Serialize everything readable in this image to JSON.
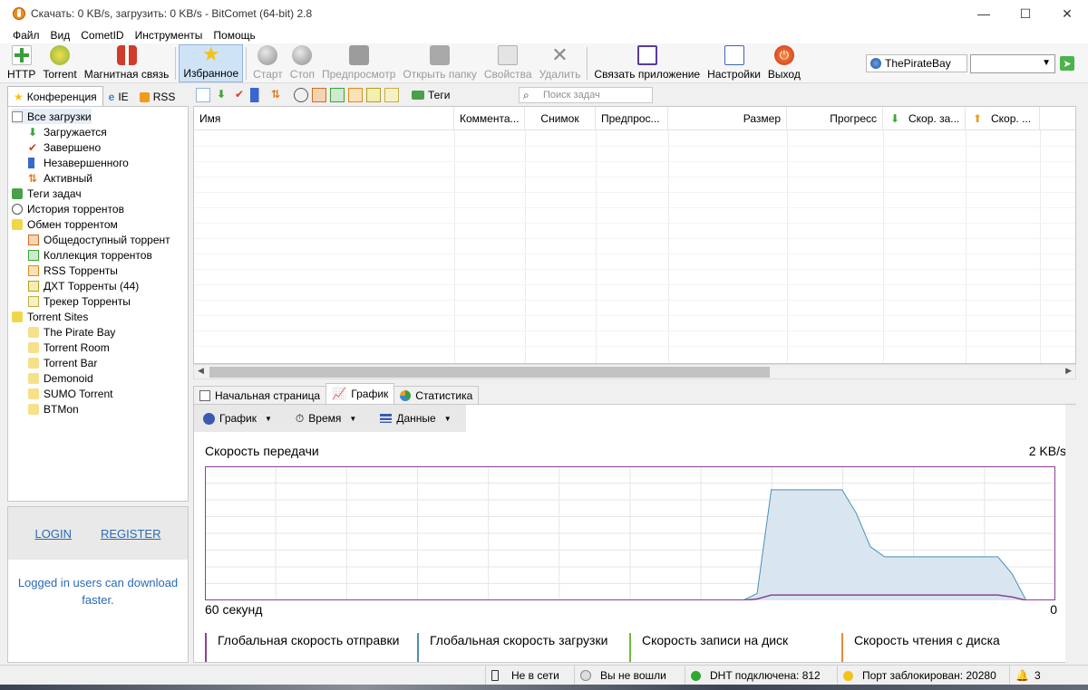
{
  "window": {
    "title": "Скачать: 0 KB/s, загрузить: 0 KB/s - BitComet (64-bit) 2.8",
    "min": "—",
    "max": "☐",
    "close": "✕"
  },
  "menu": [
    "Файл",
    "Вид",
    "CometID",
    "Инструменты",
    "Помощь"
  ],
  "toolbar": {
    "http": "HTTP",
    "torrent": "Torrent",
    "magnet": "Магнитная связь",
    "favorites": "Избранное",
    "start": "Старт",
    "stop": "Стоп",
    "preview": "Предпросмотр",
    "open_folder": "Открыть папку",
    "properties": "Свойства",
    "delete": "Удалить",
    "link_app": "Связать приложение",
    "settings": "Настройки",
    "exit": "Выход"
  },
  "tracker_select": "ThePirateBay",
  "left_tabs": {
    "conf": "Конференция",
    "ie": "IE",
    "rss": "RSS"
  },
  "tree": {
    "all": "Все загрузки",
    "downloading": "Загружается",
    "completed": "Завершено",
    "incomplete": "Незавершенного",
    "active": "Активный",
    "tags": "Теги задач",
    "history": "История торрентов",
    "exchange": "Обмен торрентом",
    "public": "Общедоступный торрент",
    "collection": "Коллекция торрентов",
    "rss": "RSS Торренты",
    "dht": "ДХТ Торренты (44)",
    "tracker": "Трекер Торренты",
    "sites": "Torrent Sites",
    "piratebay": "The Pirate Bay",
    "room": "Torrent Room",
    "bar": "Torrent Bar",
    "demonoid": "Demonoid",
    "sumo": "SUMO Torrent",
    "btmon": "BTMon"
  },
  "login": {
    "login": "LOGIN",
    "register": "REGISTER",
    "msg1": "Logged in users can download",
    "msg2": "faster."
  },
  "subbar": {
    "tags": "Теги",
    "search_placeholder": "Поиск задач"
  },
  "columns": {
    "name": "Имя",
    "comment": "Коммента...",
    "snapshot": "Снимок",
    "preview": "Предпрос...",
    "size": "Размер",
    "progress": "Прогресс",
    "dl": "Скор. за...",
    "ul": "Скор. ..."
  },
  "bottom_tabs": {
    "home": "Начальная страница",
    "graph": "График",
    "stats": "Статистика"
  },
  "graph": {
    "tool_graph": "График",
    "tool_time": "Время",
    "tool_data": "Данные",
    "title": "Скорость передачи",
    "max": "2 KB/s",
    "left": "60 секунд",
    "right": "0",
    "legend": {
      "upload": "Глобальная скорость отправки",
      "download": "Глобальная скорость загрузки",
      "disk_write": "Скорость записи на диск",
      "disk_read": "Скорость чтения с диска"
    }
  },
  "chart_data": {
    "type": "area",
    "title": "Скорость передачи",
    "xlabel": "",
    "ylabel": "",
    "x_range_label": [
      "60 секунд",
      "0"
    ],
    "y_max_label": "2 KB/s",
    "series": [
      {
        "name": "Глобальная скорость загрузки",
        "color": "#4a8fb8",
        "values": [
          0,
          0,
          0,
          0,
          0,
          0,
          0,
          0,
          0,
          0,
          0,
          0,
          0,
          0,
          0,
          0,
          0,
          0,
          0,
          0,
          0,
          0,
          0,
          0,
          0,
          0,
          0,
          0,
          0,
          0,
          0,
          0,
          0,
          0,
          0,
          0,
          0,
          0,
          0,
          0.1,
          1.65,
          1.65,
          1.65,
          1.65,
          1.65,
          1.65,
          1.3,
          0.8,
          0.65,
          0.65,
          0.65,
          0.65,
          0.65,
          0.65,
          0.65,
          0.65,
          0.65,
          0.4,
          0,
          0,
          0
        ]
      },
      {
        "name": "Глобальная скорость отправки",
        "color": "#8e3f98",
        "values": [
          0,
          0,
          0,
          0,
          0,
          0,
          0,
          0,
          0,
          0,
          0,
          0,
          0,
          0,
          0,
          0,
          0,
          0,
          0,
          0,
          0,
          0,
          0,
          0,
          0,
          0,
          0,
          0,
          0,
          0,
          0,
          0,
          0,
          0,
          0,
          0,
          0,
          0,
          0,
          0.02,
          0.08,
          0.08,
          0.08,
          0.08,
          0.08,
          0.08,
          0.08,
          0.08,
          0.08,
          0.08,
          0.08,
          0.08,
          0.08,
          0.08,
          0.08,
          0.08,
          0.08,
          0.05,
          0,
          0,
          0
        ]
      }
    ]
  },
  "status": {
    "offline": "Не в сети",
    "not_logged": "Вы не вошли",
    "dht": "DHT подключена: 812",
    "port": "Порт заблокирован: 20280",
    "alerts": "3"
  },
  "colors": {
    "accent": "#2a6ab6",
    "selected": "#cfe3f7",
    "graph_border": "#8e3f98"
  }
}
